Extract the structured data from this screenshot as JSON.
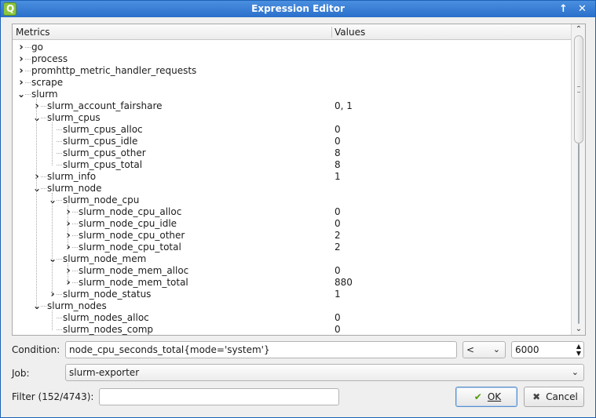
{
  "window": {
    "title": "Expression Editor",
    "app_icon_letter": "Q"
  },
  "titlebar": {
    "pin_glyph": "↑",
    "close_glyph": "✕"
  },
  "tree": {
    "headers": {
      "metrics": "Metrics",
      "values": "Values"
    },
    "rows": [
      {
        "label": "go",
        "value": "",
        "depth": 0,
        "expander": "collapsed"
      },
      {
        "label": "process",
        "value": "",
        "depth": 0,
        "expander": "collapsed"
      },
      {
        "label": "promhttp_metric_handler_requests",
        "value": "",
        "depth": 0,
        "expander": "collapsed"
      },
      {
        "label": "scrape",
        "value": "",
        "depth": 0,
        "expander": "collapsed"
      },
      {
        "label": "slurm",
        "value": "",
        "depth": 0,
        "expander": "expanded"
      },
      {
        "label": "slurm_account_fairshare",
        "value": "0, 1",
        "depth": 1,
        "expander": "collapsed"
      },
      {
        "label": "slurm_cpus",
        "value": "",
        "depth": 1,
        "expander": "expanded"
      },
      {
        "label": "slurm_cpus_alloc",
        "value": "0",
        "depth": 2,
        "expander": "none"
      },
      {
        "label": "slurm_cpus_idle",
        "value": "0",
        "depth": 2,
        "expander": "none"
      },
      {
        "label": "slurm_cpus_other",
        "value": "8",
        "depth": 2,
        "expander": "none"
      },
      {
        "label": "slurm_cpus_total",
        "value": "8",
        "depth": 2,
        "expander": "none"
      },
      {
        "label": "slurm_info",
        "value": "1",
        "depth": 1,
        "expander": "collapsed"
      },
      {
        "label": "slurm_node",
        "value": "",
        "depth": 1,
        "expander": "expanded"
      },
      {
        "label": "slurm_node_cpu",
        "value": "",
        "depth": 2,
        "expander": "expanded"
      },
      {
        "label": "slurm_node_cpu_alloc",
        "value": "0",
        "depth": 3,
        "expander": "collapsed"
      },
      {
        "label": "slurm_node_cpu_idle",
        "value": "0",
        "depth": 3,
        "expander": "collapsed"
      },
      {
        "label": "slurm_node_cpu_other",
        "value": "2",
        "depth": 3,
        "expander": "collapsed"
      },
      {
        "label": "slurm_node_cpu_total",
        "value": "2",
        "depth": 3,
        "expander": "collapsed"
      },
      {
        "label": "slurm_node_mem",
        "value": "",
        "depth": 2,
        "expander": "expanded"
      },
      {
        "label": "slurm_node_mem_alloc",
        "value": "0",
        "depth": 3,
        "expander": "collapsed"
      },
      {
        "label": "slurm_node_mem_total",
        "value": "880",
        "depth": 3,
        "expander": "collapsed"
      },
      {
        "label": "slurm_node_status",
        "value": "1",
        "depth": 2,
        "expander": "collapsed"
      },
      {
        "label": "slurm_nodes",
        "value": "",
        "depth": 1,
        "expander": "expanded"
      },
      {
        "label": "slurm_nodes_alloc",
        "value": "0",
        "depth": 2,
        "expander": "none"
      },
      {
        "label": "slurm_nodes_comp",
        "value": "0",
        "depth": 2,
        "expander": "none"
      }
    ],
    "scroll_up_glyph": "⌃",
    "scroll_down_glyph": "⌄"
  },
  "condition": {
    "label": "Condition:",
    "expression": "node_cpu_seconds_total{mode='system'}",
    "operator": "<",
    "threshold": "6000"
  },
  "job": {
    "label": "Job:",
    "selected": "slurm-exporter"
  },
  "filter": {
    "label": "Filter (152/4743):",
    "value": ""
  },
  "buttons": {
    "ok_label": "OK",
    "cancel_label": "Cancel"
  },
  "icons": {
    "ok": "check-icon",
    "cancel": "x-icon"
  },
  "colors": {
    "titlebar": "#2a6fca",
    "ok_check": "#4e9a06",
    "app_icon": "#8cc63e"
  }
}
